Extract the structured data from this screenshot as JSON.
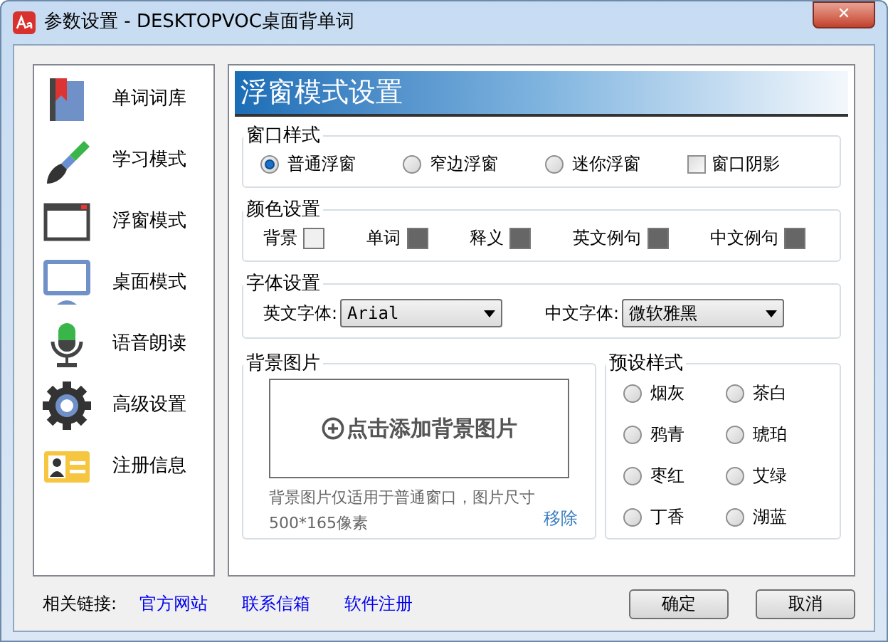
{
  "window": {
    "title": "参数设置 - DESKTOPVOC桌面背单词",
    "close": "✕"
  },
  "sidebar": {
    "items": [
      {
        "label": "单词词库"
      },
      {
        "label": "学习模式"
      },
      {
        "label": "浮窗模式"
      },
      {
        "label": "桌面模式"
      },
      {
        "label": "语音朗读"
      },
      {
        "label": "高级设置"
      },
      {
        "label": "注册信息"
      }
    ]
  },
  "header": "浮窗模式设置",
  "window_style": {
    "title": "窗口样式",
    "options": [
      {
        "label": "普通浮窗",
        "selected": true
      },
      {
        "label": "窄边浮窗",
        "selected": false
      },
      {
        "label": "迷你浮窗",
        "selected": false
      }
    ],
    "shadow": {
      "label": "窗口阴影",
      "checked": false
    }
  },
  "colors": {
    "title": "颜色设置",
    "items": [
      {
        "label": "背景",
        "color": "#f0f0f0"
      },
      {
        "label": "单词",
        "color": "#666666"
      },
      {
        "label": "释义",
        "color": "#666666"
      },
      {
        "label": "英文例句",
        "color": "#666666"
      },
      {
        "label": "中文例句",
        "color": "#666666"
      }
    ]
  },
  "fonts": {
    "title": "字体设置",
    "english_label": "英文字体:",
    "english_value": "Arial",
    "chinese_label": "中文字体:",
    "chinese_value": "微软雅黑"
  },
  "background_image": {
    "title": "背景图片",
    "add": "点击添加背景图片",
    "note": "背景图片仅适用于普通窗口，图片尺寸",
    "size": "500*165像素",
    "remove": "移除"
  },
  "presets": {
    "title": "预设样式",
    "items": [
      {
        "label": "烟灰",
        "selected": false
      },
      {
        "label": "茶白",
        "selected": false
      },
      {
        "label": "鸦青",
        "selected": false
      },
      {
        "label": "琥珀",
        "selected": false
      },
      {
        "label": "枣红",
        "selected": false
      },
      {
        "label": "艾绿",
        "selected": false
      },
      {
        "label": "丁香",
        "selected": false
      },
      {
        "label": "湖蓝",
        "selected": false
      }
    ]
  },
  "footer": {
    "label": "相关链接:",
    "links": [
      "官方网站",
      "联系信箱",
      "软件注册"
    ],
    "buttons": [
      "确定",
      "取消"
    ]
  }
}
